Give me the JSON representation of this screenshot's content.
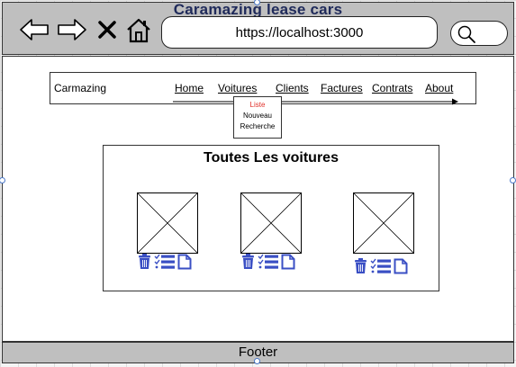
{
  "window": {
    "title": "Caramazing lease cars"
  },
  "toolbar": {
    "back_icon": "back-arrow-icon",
    "forward_icon": "forward-arrow-icon",
    "close_icon": "close-icon",
    "home_icon": "home-icon",
    "url": "https://localhost:3000",
    "search_icon": "search-icon"
  },
  "navbar": {
    "brand": "Carmazing",
    "items": [
      {
        "label": "Home"
      },
      {
        "label": "Voitures"
      },
      {
        "label": "Clients"
      },
      {
        "label": "Factures"
      },
      {
        "label": "Contrats"
      },
      {
        "label": "About"
      }
    ]
  },
  "dropdown": {
    "items": [
      {
        "label": "Liste",
        "active": true
      },
      {
        "label": "Nouveau",
        "active": false
      },
      {
        "label": "Recherche",
        "active": false
      }
    ],
    "active_color": "#e0302a"
  },
  "content": {
    "title": "Toutes Les voitures",
    "cars": [
      {
        "image": "image-placeholder",
        "actions": [
          "trash-icon",
          "list-icon",
          "document-icon"
        ]
      },
      {
        "image": "image-placeholder",
        "actions": [
          "trash-icon",
          "list-icon",
          "document-icon"
        ]
      },
      {
        "image": "image-placeholder",
        "actions": [
          "trash-icon",
          "list-icon",
          "document-icon"
        ]
      }
    ]
  },
  "footer": {
    "label": "Footer"
  },
  "colors": {
    "chrome": "#bfbfbf",
    "title_text": "#1f2a5a",
    "action_icon": "#3a4fc4",
    "selection_handle": "#4a78c8"
  }
}
